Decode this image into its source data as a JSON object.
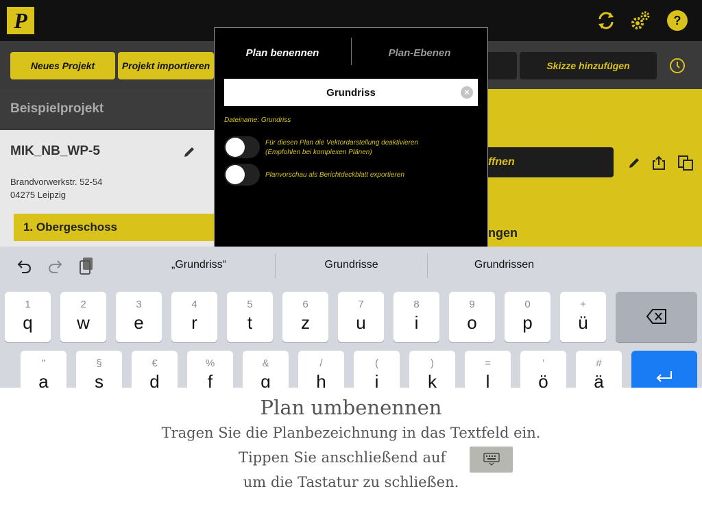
{
  "app": {
    "logo_letter": "P",
    "toolbar": {
      "new_project": "Neues Projekt",
      "import_project": "Projekt importieren",
      "add_sketch": "Skizze hinzufügen"
    },
    "project_header": "Beispielprojekt",
    "project": {
      "name": "MIK_NB_WP-5",
      "address_line1": "Brandvorwerkstr. 52-54",
      "address_line2": "04275 Leipzig",
      "floor": "1. Obergeschoss"
    },
    "open_button_partial": "ffnen",
    "right_label_partial": "ngen"
  },
  "modal": {
    "tabs": [
      "Plan benennen",
      "Plan-Ebenen"
    ],
    "name_value": "Grundriss",
    "filename_label": "Dateiname: Grundriss",
    "toggle1_line1": "Für diesen Plan die Vektordarstellung deaktivieren",
    "toggle1_line2": "(Empfohlen bei komplexen Plänen)",
    "toggle2_label": "Planvorschau als Berichtdeckblatt exportieren"
  },
  "keyboard": {
    "predictions": [
      "„Grundriss“",
      "Grundrisse",
      "Grundrissen"
    ],
    "row1": [
      {
        "hint": "1",
        "key": "q"
      },
      {
        "hint": "2",
        "key": "w"
      },
      {
        "hint": "3",
        "key": "e"
      },
      {
        "hint": "4",
        "key": "r"
      },
      {
        "hint": "5",
        "key": "t"
      },
      {
        "hint": "6",
        "key": "z"
      },
      {
        "hint": "7",
        "key": "u"
      },
      {
        "hint": "8",
        "key": "i"
      },
      {
        "hint": "9",
        "key": "o"
      },
      {
        "hint": "0",
        "key": "p"
      },
      {
        "hint": "+",
        "key": "ü"
      }
    ],
    "row2": [
      {
        "hint": "\"",
        "key": "a"
      },
      {
        "hint": "§",
        "key": "s"
      },
      {
        "hint": "€",
        "key": "d"
      },
      {
        "hint": "%",
        "key": "f"
      },
      {
        "hint": "&",
        "key": "g"
      },
      {
        "hint": "/",
        "key": "h"
      },
      {
        "hint": "(",
        "key": "j"
      },
      {
        "hint": ")",
        "key": "k"
      },
      {
        "hint": "=",
        "key": "l"
      },
      {
        "hint": "’",
        "key": "ö"
      },
      {
        "hint": "#",
        "key": "ä"
      }
    ]
  },
  "instruction": {
    "title": "Plan umbenennen",
    "line1": "Tragen Sie die Planbezeichnung in das Textfeld ein.",
    "line2": "Tippen Sie anschließend auf",
    "line3": "um die Tastatur zu schließen."
  },
  "colors": {
    "brand_yellow": "#d9c31a",
    "keyboard_blue": "#1a7cf5"
  }
}
